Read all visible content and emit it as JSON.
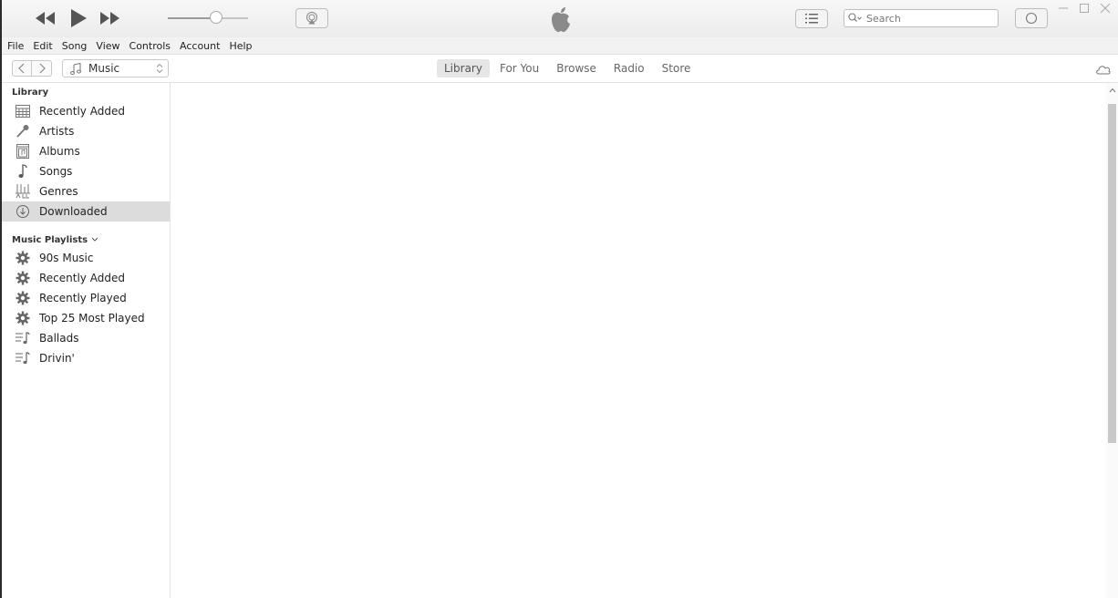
{
  "toolbar": {
    "search_placeholder": "Search"
  },
  "menu": [
    "File",
    "Edit",
    "Song",
    "View",
    "Controls",
    "Account",
    "Help"
  ],
  "navbar": {
    "media_kind": "Music",
    "tabs": [
      "Library",
      "For You",
      "Browse",
      "Radio",
      "Store"
    ],
    "active_tab": "Library"
  },
  "sidebar": {
    "library_heading": "Library",
    "library_items": [
      {
        "label": "Recently Added",
        "icon": "grid-icon"
      },
      {
        "label": "Artists",
        "icon": "microphone-icon"
      },
      {
        "label": "Albums",
        "icon": "album-icon"
      },
      {
        "label": "Songs",
        "icon": "music-note-icon"
      },
      {
        "label": "Genres",
        "icon": "genres-icon"
      },
      {
        "label": "Downloaded",
        "icon": "download-icon",
        "selected": true
      }
    ],
    "playlists_heading": "Music Playlists",
    "playlist_items": [
      {
        "label": "90s Music",
        "icon": "smart-playlist-gear-icon"
      },
      {
        "label": "Recently Added",
        "icon": "smart-playlist-gear-icon"
      },
      {
        "label": "Recently Played",
        "icon": "smart-playlist-gear-icon"
      },
      {
        "label": "Top 25 Most Played",
        "icon": "smart-playlist-gear-icon"
      },
      {
        "label": "Ballads",
        "icon": "playlist-icon"
      },
      {
        "label": "Drivin'",
        "icon": "playlist-icon"
      }
    ]
  },
  "volume_level": 0.6,
  "colors": {
    "selection": "#dcdcdc",
    "toolbar_bg": "#f2f2f2"
  }
}
